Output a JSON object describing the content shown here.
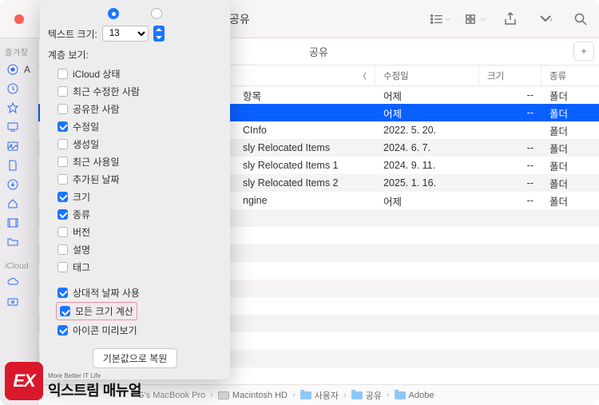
{
  "toolbar": {
    "title": "공유"
  },
  "sidebar": {
    "section1_label": "즐겨찾",
    "section2_label": "iCloud",
    "items": [
      {
        "icon": "airdrop",
        "label": "A"
      },
      {
        "icon": "clock",
        "label": ""
      },
      {
        "icon": "apps",
        "label": ""
      },
      {
        "icon": "desktop",
        "label": ""
      },
      {
        "icon": "image",
        "label": ""
      },
      {
        "icon": "doc",
        "label": ""
      },
      {
        "icon": "download",
        "label": ""
      },
      {
        "icon": "home",
        "label": ""
      },
      {
        "icon": "movie",
        "label": ""
      },
      {
        "icon": "folder",
        "label": ""
      }
    ],
    "icloud_items": [
      {
        "icon": "cloud",
        "label": ""
      },
      {
        "icon": "share",
        "label": ""
      }
    ]
  },
  "header": {
    "title": "공유",
    "columns": {
      "name": "",
      "mod": "수정일",
      "size": "크기",
      "kind": "종류"
    }
  },
  "rows": [
    {
      "name": "항목",
      "mod": "어제",
      "size": "--",
      "kind": "폴더",
      "sel": false
    },
    {
      "name": "",
      "mod": "어제",
      "size": "--",
      "kind": "폴더",
      "sel": true
    },
    {
      "name": "CInfo",
      "mod": "2022. 5. 20.",
      "size": "",
      "kind": "폴더",
      "sel": false
    },
    {
      "name": "sly Relocated Items",
      "mod": "2024. 6. 7.",
      "size": "--",
      "kind": "폴더",
      "sel": false
    },
    {
      "name": "sly Relocated Items 1",
      "mod": "2024. 9. 11.",
      "size": "--",
      "kind": "폴더",
      "sel": false
    },
    {
      "name": "sly Relocated Items 2",
      "mod": "2025. 1. 16.",
      "size": "--",
      "kind": "폴더",
      "sel": false
    },
    {
      "name": "ngine",
      "mod": "어제",
      "size": "--",
      "kind": "폴더",
      "sel": false
    }
  ],
  "pathbar": {
    "device": "G's MacBook Pro",
    "segments": [
      "Macintosh HD",
      "사용자",
      "공유",
      "Adobe"
    ]
  },
  "panel": {
    "text_size_label": "텍스트 크기:",
    "text_size_value": "13",
    "columns_label": "계층 보기:",
    "checks": [
      {
        "label": "iCloud 상태",
        "on": false
      },
      {
        "label": "최근 수정한 사람",
        "on": false
      },
      {
        "label": "공유한 사람",
        "on": false
      },
      {
        "label": "수정일",
        "on": true
      },
      {
        "label": "생성일",
        "on": false
      },
      {
        "label": "최근 사용일",
        "on": false
      },
      {
        "label": "추가된 날짜",
        "on": false
      },
      {
        "label": "크기",
        "on": true
      },
      {
        "label": "종류",
        "on": true
      },
      {
        "label": "버전",
        "on": false
      },
      {
        "label": "설명",
        "on": false
      },
      {
        "label": "태그",
        "on": false
      }
    ],
    "extra": [
      {
        "label": "상대적 날짜 사용",
        "on": true
      },
      {
        "label": "모든 크기 계산",
        "on": true,
        "highlight": true
      },
      {
        "label": "아이콘 미리보기",
        "on": true
      }
    ],
    "reset_label": "기본값으로 복원"
  },
  "logo": {
    "sub": "More Better IT Life",
    "main": "익스트림 매뉴얼",
    "mark": "EX"
  }
}
